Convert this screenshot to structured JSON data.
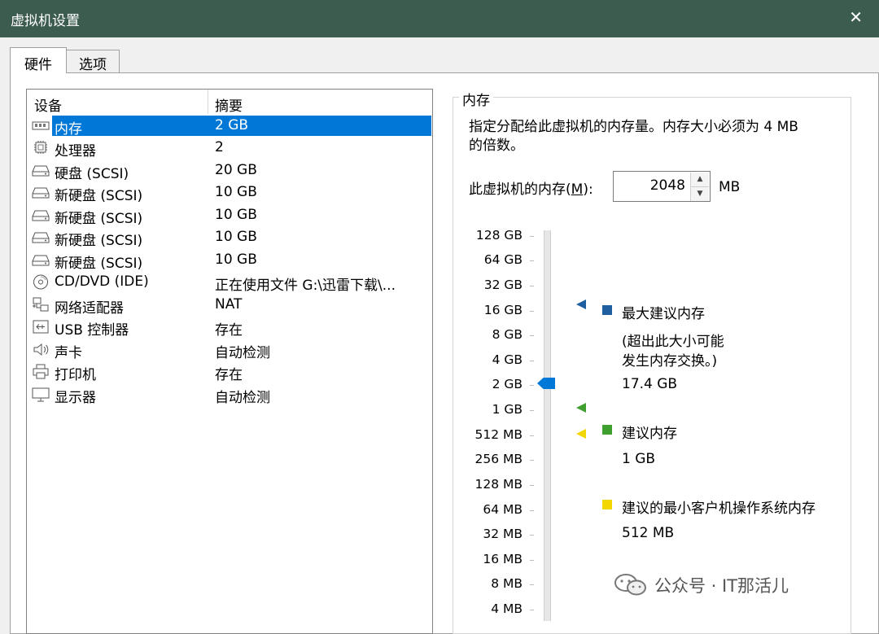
{
  "window": {
    "title": "虚拟机设置",
    "close_glyph": "✕"
  },
  "tabs": [
    {
      "label": "硬件",
      "active": true
    },
    {
      "label": "选项",
      "active": false
    }
  ],
  "device_list": {
    "col_device": "设备",
    "col_summary": "摘要",
    "rows": [
      {
        "icon": "memory-icon",
        "name": "内存",
        "summary": "2 GB",
        "selected": true
      },
      {
        "icon": "processor-icon",
        "name": "处理器",
        "summary": "2"
      },
      {
        "icon": "hard-disk-icon",
        "name": "硬盘 (SCSI)",
        "summary": "20 GB"
      },
      {
        "icon": "hard-disk-icon",
        "name": "新硬盘 (SCSI)",
        "summary": "10 GB"
      },
      {
        "icon": "hard-disk-icon",
        "name": "新硬盘 (SCSI)",
        "summary": "10 GB"
      },
      {
        "icon": "hard-disk-icon",
        "name": "新硬盘 (SCSI)",
        "summary": "10 GB"
      },
      {
        "icon": "hard-disk-icon",
        "name": "新硬盘 (SCSI)",
        "summary": "10 GB"
      },
      {
        "icon": "cd-dvd-icon",
        "name": "CD/DVD (IDE)",
        "summary": "正在使用文件 G:\\迅雷下载\\..."
      },
      {
        "icon": "network-adapter-icon",
        "name": "网络适配器",
        "summary": "NAT"
      },
      {
        "icon": "usb-icon",
        "name": "USB 控制器",
        "summary": "存在"
      },
      {
        "icon": "sound-card-icon",
        "name": "声卡",
        "summary": "自动检测"
      },
      {
        "icon": "printer-icon",
        "name": "打印机",
        "summary": "存在"
      },
      {
        "icon": "display-icon",
        "name": "显示器",
        "summary": "自动检测"
      }
    ]
  },
  "memory_panel": {
    "group_title": "内存",
    "description_line1": "指定分配给此虚拟机的内存量。内存大小必须为 4 MB",
    "description_line2": "的倍数。",
    "field_label_pre": "此虚拟机的内存(",
    "field_label_key": "M",
    "field_label_post": "):",
    "value": "2048",
    "unit": "MB",
    "scale_ticks": [
      "128 GB",
      "64 GB",
      "32 GB",
      "16 GB",
      "8 GB",
      "4 GB",
      "2 GB",
      "1 GB",
      "512 MB",
      "256 MB",
      "128 MB",
      "64 MB",
      "32 MB",
      "16 MB",
      "8 MB",
      "4 MB"
    ],
    "current_setting": "2 GB",
    "legend": {
      "max": {
        "title": "最大建议内存",
        "note1": "(超出此大小可能",
        "note2": "发生内存交换。)",
        "value": "17.4 GB",
        "color": "#1f5f9f"
      },
      "recommended": {
        "title": "建议内存",
        "value": "1 GB",
        "color": "#3f9f2f"
      },
      "min_guest": {
        "title": "建议的最小客户机操作系统内存",
        "value": "512 MB",
        "color": "#f2d600"
      }
    }
  },
  "watermark": {
    "text": "公众号 · IT那活儿"
  },
  "colors": {
    "titlebar": "#3d5c50",
    "selection": "#0078d7",
    "slider_thumb": "#0078d7"
  }
}
